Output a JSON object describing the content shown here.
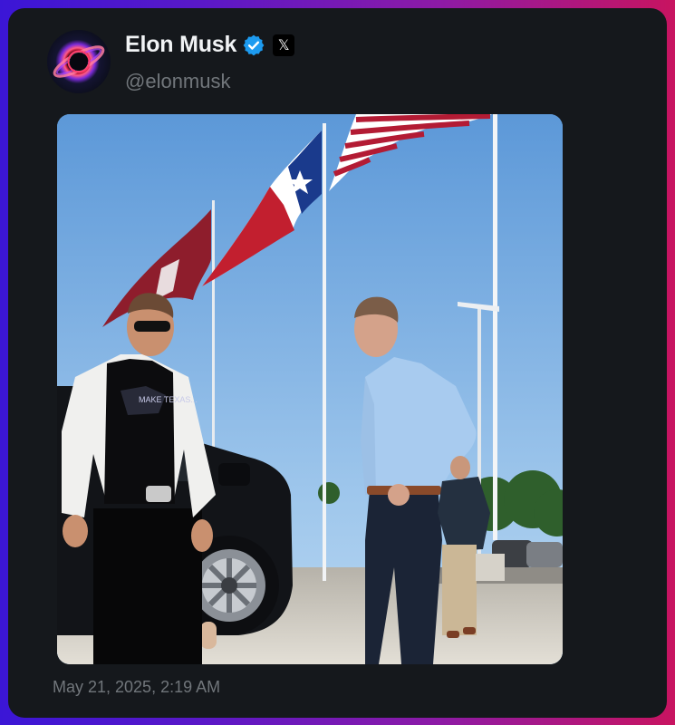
{
  "post": {
    "author": {
      "display_name": "Elon Musk",
      "handle": "@elonmusk",
      "avatar_icon": "black-hole-avatar",
      "verified": true,
      "verified_color": "#1d9bf0",
      "affiliation_badge": "𝕏"
    },
    "media": {
      "shirt_text": "MAKE TEXAS..."
    },
    "timestamp": "May 21, 2025, 2:19 AM"
  },
  "colors": {
    "card_background": "#15181c",
    "name_text": "#f1f3f5",
    "secondary_text": "#71767b"
  }
}
